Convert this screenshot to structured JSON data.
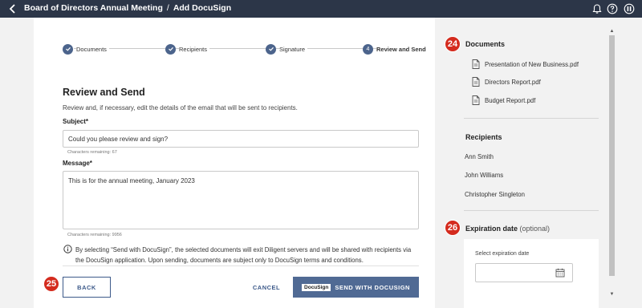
{
  "topbar": {
    "breadcrumb_parent": "Board of Directors Annual Meeting",
    "separator": "/",
    "breadcrumb_current": "Add DocuSign"
  },
  "stepper": {
    "steps": [
      {
        "label": "Documents",
        "state": "done"
      },
      {
        "label": "Recipients",
        "state": "done"
      },
      {
        "label": "Signature",
        "state": "done"
      },
      {
        "label": "Review and Send",
        "state": "active",
        "number": "4"
      }
    ]
  },
  "form": {
    "title": "Review and Send",
    "description": "Review and, if necessary, edit the details of the email that will be sent to recipients.",
    "subject_label": "Subject*",
    "subject_value": "Could you please review and sign?",
    "subject_hint": "Characters remaining: 67",
    "message_label": "Message*",
    "message_value": "This is for the annual meeting, January 2023",
    "message_hint": "Characters remaining: 9956",
    "notice_text": "By selecting “Send with DocuSign”, the selected documents will exit Diligent servers and will be shared with recipients via the DocuSign application. Upon sending, documents are subject only to DocuSign terms and conditions."
  },
  "buttons": {
    "back_label": "BACK",
    "cancel_label": "CANCEL",
    "send_logo": "DocuSign",
    "send_label": "SEND WITH DOCUSIGN"
  },
  "badges": {
    "b24": "24",
    "b25": "25",
    "b26": "26"
  },
  "side": {
    "documents_title": "Documents",
    "documents": [
      "Presentation of New Business.pdf",
      "Directors Report.pdf",
      "Budget Report.pdf"
    ],
    "recipients_title": "Recipients",
    "recipients": [
      "Ann Smith",
      "John Williams",
      "Christopher Singleton"
    ],
    "expiration_title": "Expiration date",
    "expiration_optional": "(optional)",
    "expiration_label": "Select expiration date"
  },
  "icons": {
    "back": "chevron-left-icon",
    "bell": "bell-icon",
    "help": "help-icon",
    "profile": "profile-icon",
    "check": "check-icon",
    "document": "document-icon",
    "info": "info-icon",
    "calendar": "calendar-icon"
  },
  "colors": {
    "topbar": "#2c3648",
    "accent": "#4c648c",
    "send_button": "#506a94",
    "badge": "#d42b1e"
  }
}
